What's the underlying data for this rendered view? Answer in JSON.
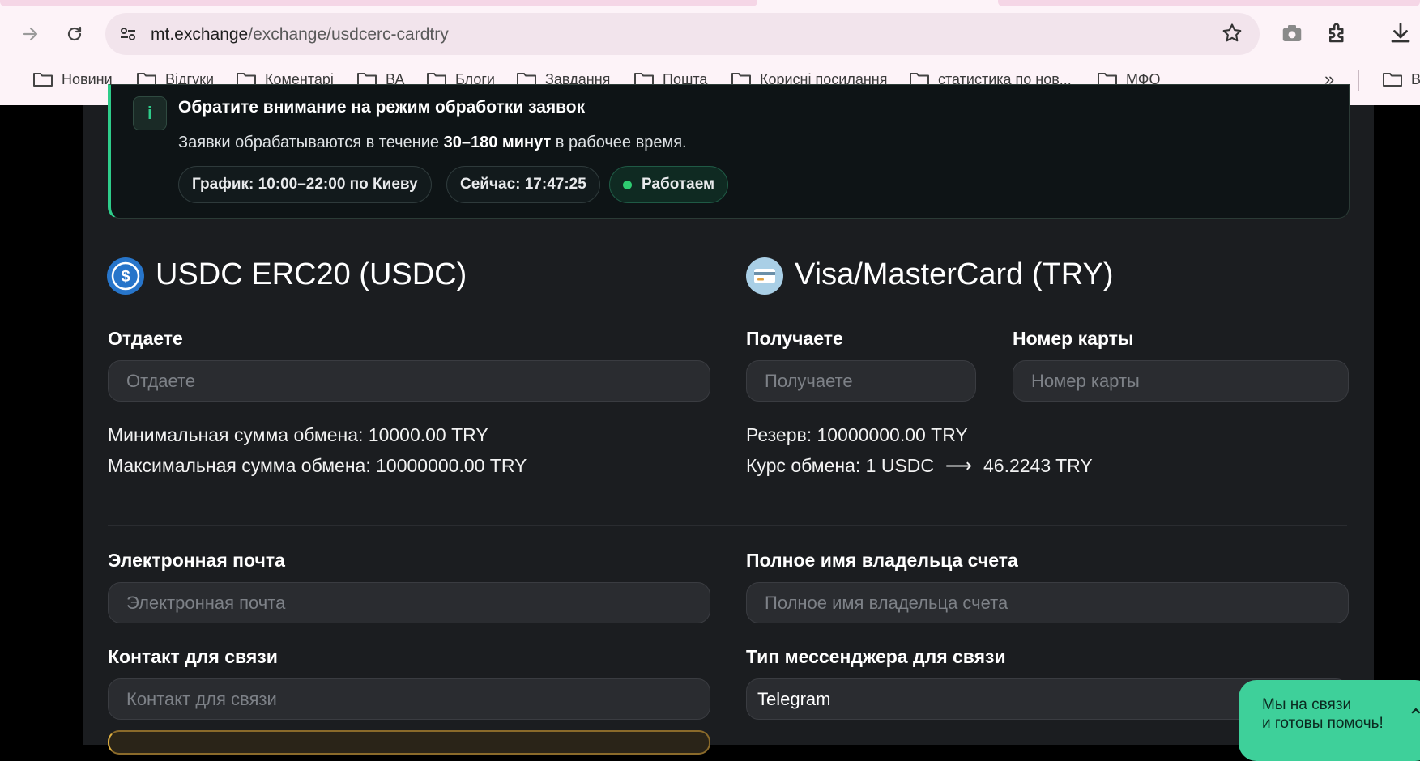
{
  "browser": {
    "url_domain": "mt.exchange",
    "url_path": "/exchange/usdcerc-cardtry",
    "bookmarks": [
      "Новини",
      "Відгуки",
      "Коментарі",
      "ВА",
      "Блоги",
      "Завдання",
      "Пошта",
      "Корисні посилання",
      "статистика по нов...",
      "МФО",
      "В"
    ],
    "more_label": "»"
  },
  "notice": {
    "icon": "i",
    "title": "Обратите внимание на режим обработки заявок",
    "text_before": "Заявки обрабатываются в течение ",
    "text_bold": "30–180 минут",
    "text_after": " в рабочее время.",
    "chip_schedule": "График: 10:00–22:00 по Киеву",
    "chip_now": "Сейчас: 17:47:25",
    "chip_status": "Работаем"
  },
  "give": {
    "currency_title": "USDC ERC20 (USDC)",
    "label": "Отдаете",
    "placeholder": "Отдаете",
    "min_line": "Минимальная сумма обмена: 10000.00 TRY",
    "max_line": "Максимальная сумма обмена: 10000000.00 TRY"
  },
  "receive": {
    "currency_title": "Visa/MasterCard (TRY)",
    "label": "Получаете",
    "placeholder": "Получаете",
    "card_label": "Номер карты",
    "card_placeholder": "Номер карты",
    "reserve_line": "Резерв: 10000000.00 TRY",
    "rate_prefix": "Курс обмена: 1 USDC",
    "rate_arrow": "⟶",
    "rate_value": "46.2243 TRY"
  },
  "form": {
    "email_label": "Электронная почта",
    "email_placeholder": "Электронная почта",
    "owner_label": "Полное имя владельца счета",
    "owner_placeholder": "Полное имя владельца счета",
    "contact_label": "Контакт для связи",
    "contact_placeholder": "Контакт для связи",
    "messenger_label": "Тип мессенджера для связи",
    "messenger_value": "Telegram"
  },
  "chat": {
    "line1": "Мы на связи",
    "line2": "и готовы помочь!",
    "chevron": "⌃"
  },
  "colors": {
    "accent_green": "#2ecc8a",
    "usdc_blue": "#2775ca",
    "chat_bg": "#3ed09a"
  }
}
